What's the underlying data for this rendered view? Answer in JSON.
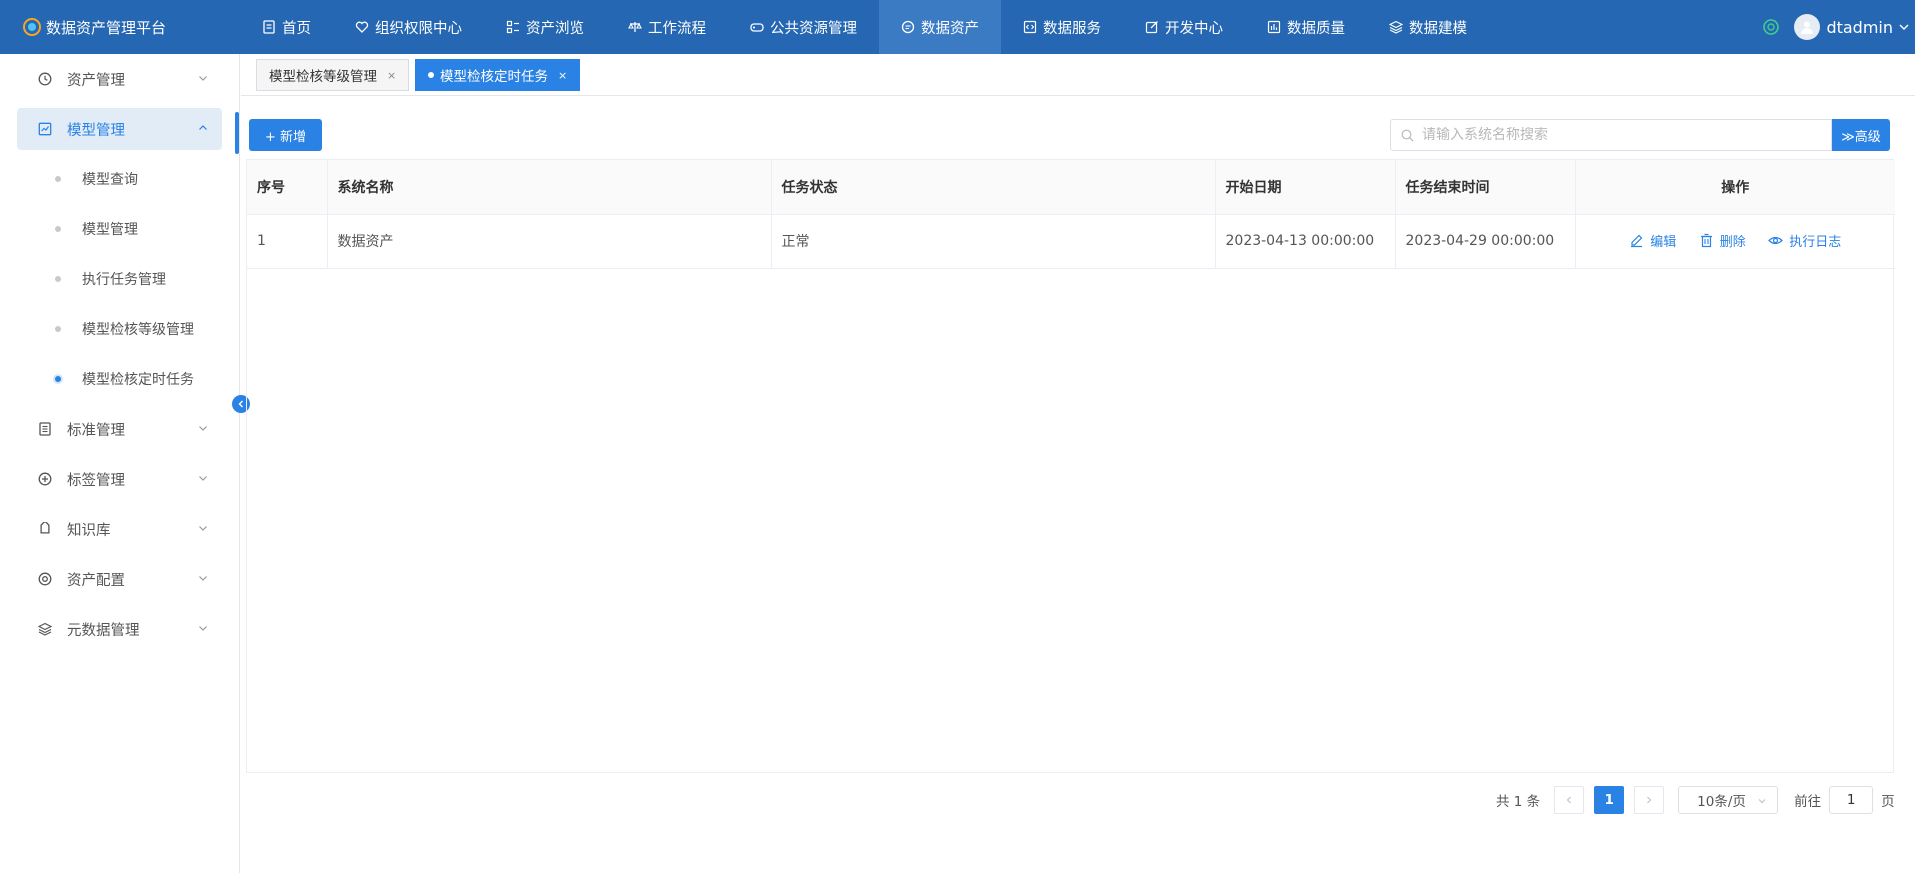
{
  "app": {
    "title": "数据资产管理平台"
  },
  "topnav": [
    {
      "label": "首页",
      "icon": "document-icon"
    },
    {
      "label": "组织权限中心",
      "icon": "heart-shield-icon"
    },
    {
      "label": "资产浏览",
      "icon": "grid-list-icon"
    },
    {
      "label": "工作流程",
      "icon": "scale-icon"
    },
    {
      "label": "公共资源管理",
      "icon": "gamepad-icon"
    },
    {
      "label": "数据资产",
      "icon": "chat-icon",
      "active": true
    },
    {
      "label": "数据服务",
      "icon": "code-icon"
    },
    {
      "label": "开发中心",
      "icon": "edit-icon"
    },
    {
      "label": "数据质量",
      "icon": "bar-chart-icon"
    },
    {
      "label": "数据建模",
      "icon": "layers-icon"
    }
  ],
  "user": {
    "name": "dtadmin"
  },
  "sidebar": {
    "items": [
      {
        "label": "资产管理",
        "icon": "clock-icon"
      },
      {
        "label": "模型管理",
        "icon": "chart-icon",
        "open": true
      },
      {
        "label": "标准管理",
        "icon": "document-icon"
      },
      {
        "label": "标签管理",
        "icon": "plus-circle-icon"
      },
      {
        "label": "知识库",
        "icon": "tag-icon"
      },
      {
        "label": "资产配置",
        "icon": "target-icon"
      },
      {
        "label": "元数据管理",
        "icon": "layers-icon"
      }
    ],
    "sub_items": [
      {
        "label": "模型查询"
      },
      {
        "label": "模型管理"
      },
      {
        "label": "执行任务管理"
      },
      {
        "label": "模型检核等级管理"
      },
      {
        "label": "模型检核定时任务",
        "active": true
      }
    ]
  },
  "tabs": [
    {
      "label": "模型检核等级管理",
      "close": "×"
    },
    {
      "label": "模型检核定时任务",
      "close": "×",
      "active": true
    }
  ],
  "toolbar": {
    "add_label": "+ 新增",
    "search_placeholder": "请输入系统名称搜索",
    "advanced_label": "≫高级"
  },
  "table": {
    "columns": [
      "序号",
      "系统名称",
      "任务状态",
      "开始日期",
      "任务结束时间",
      "操作"
    ],
    "rows": [
      {
        "index": "1",
        "system": "数据资产",
        "status": "正常",
        "start": "2023-04-13 00:00:00",
        "end": "2023-04-29 00:00:00"
      }
    ],
    "actions": {
      "edit": "编辑",
      "delete": "删除",
      "log": "执行日志"
    }
  },
  "pagination": {
    "total_text": "共 1 条",
    "current_page": "1",
    "page_size": "10条/页",
    "goto_label": "前往",
    "goto_value": "1",
    "page_suffix": "页"
  },
  "colors": {
    "header": "#2567b2",
    "accent": "#2a82e4"
  }
}
